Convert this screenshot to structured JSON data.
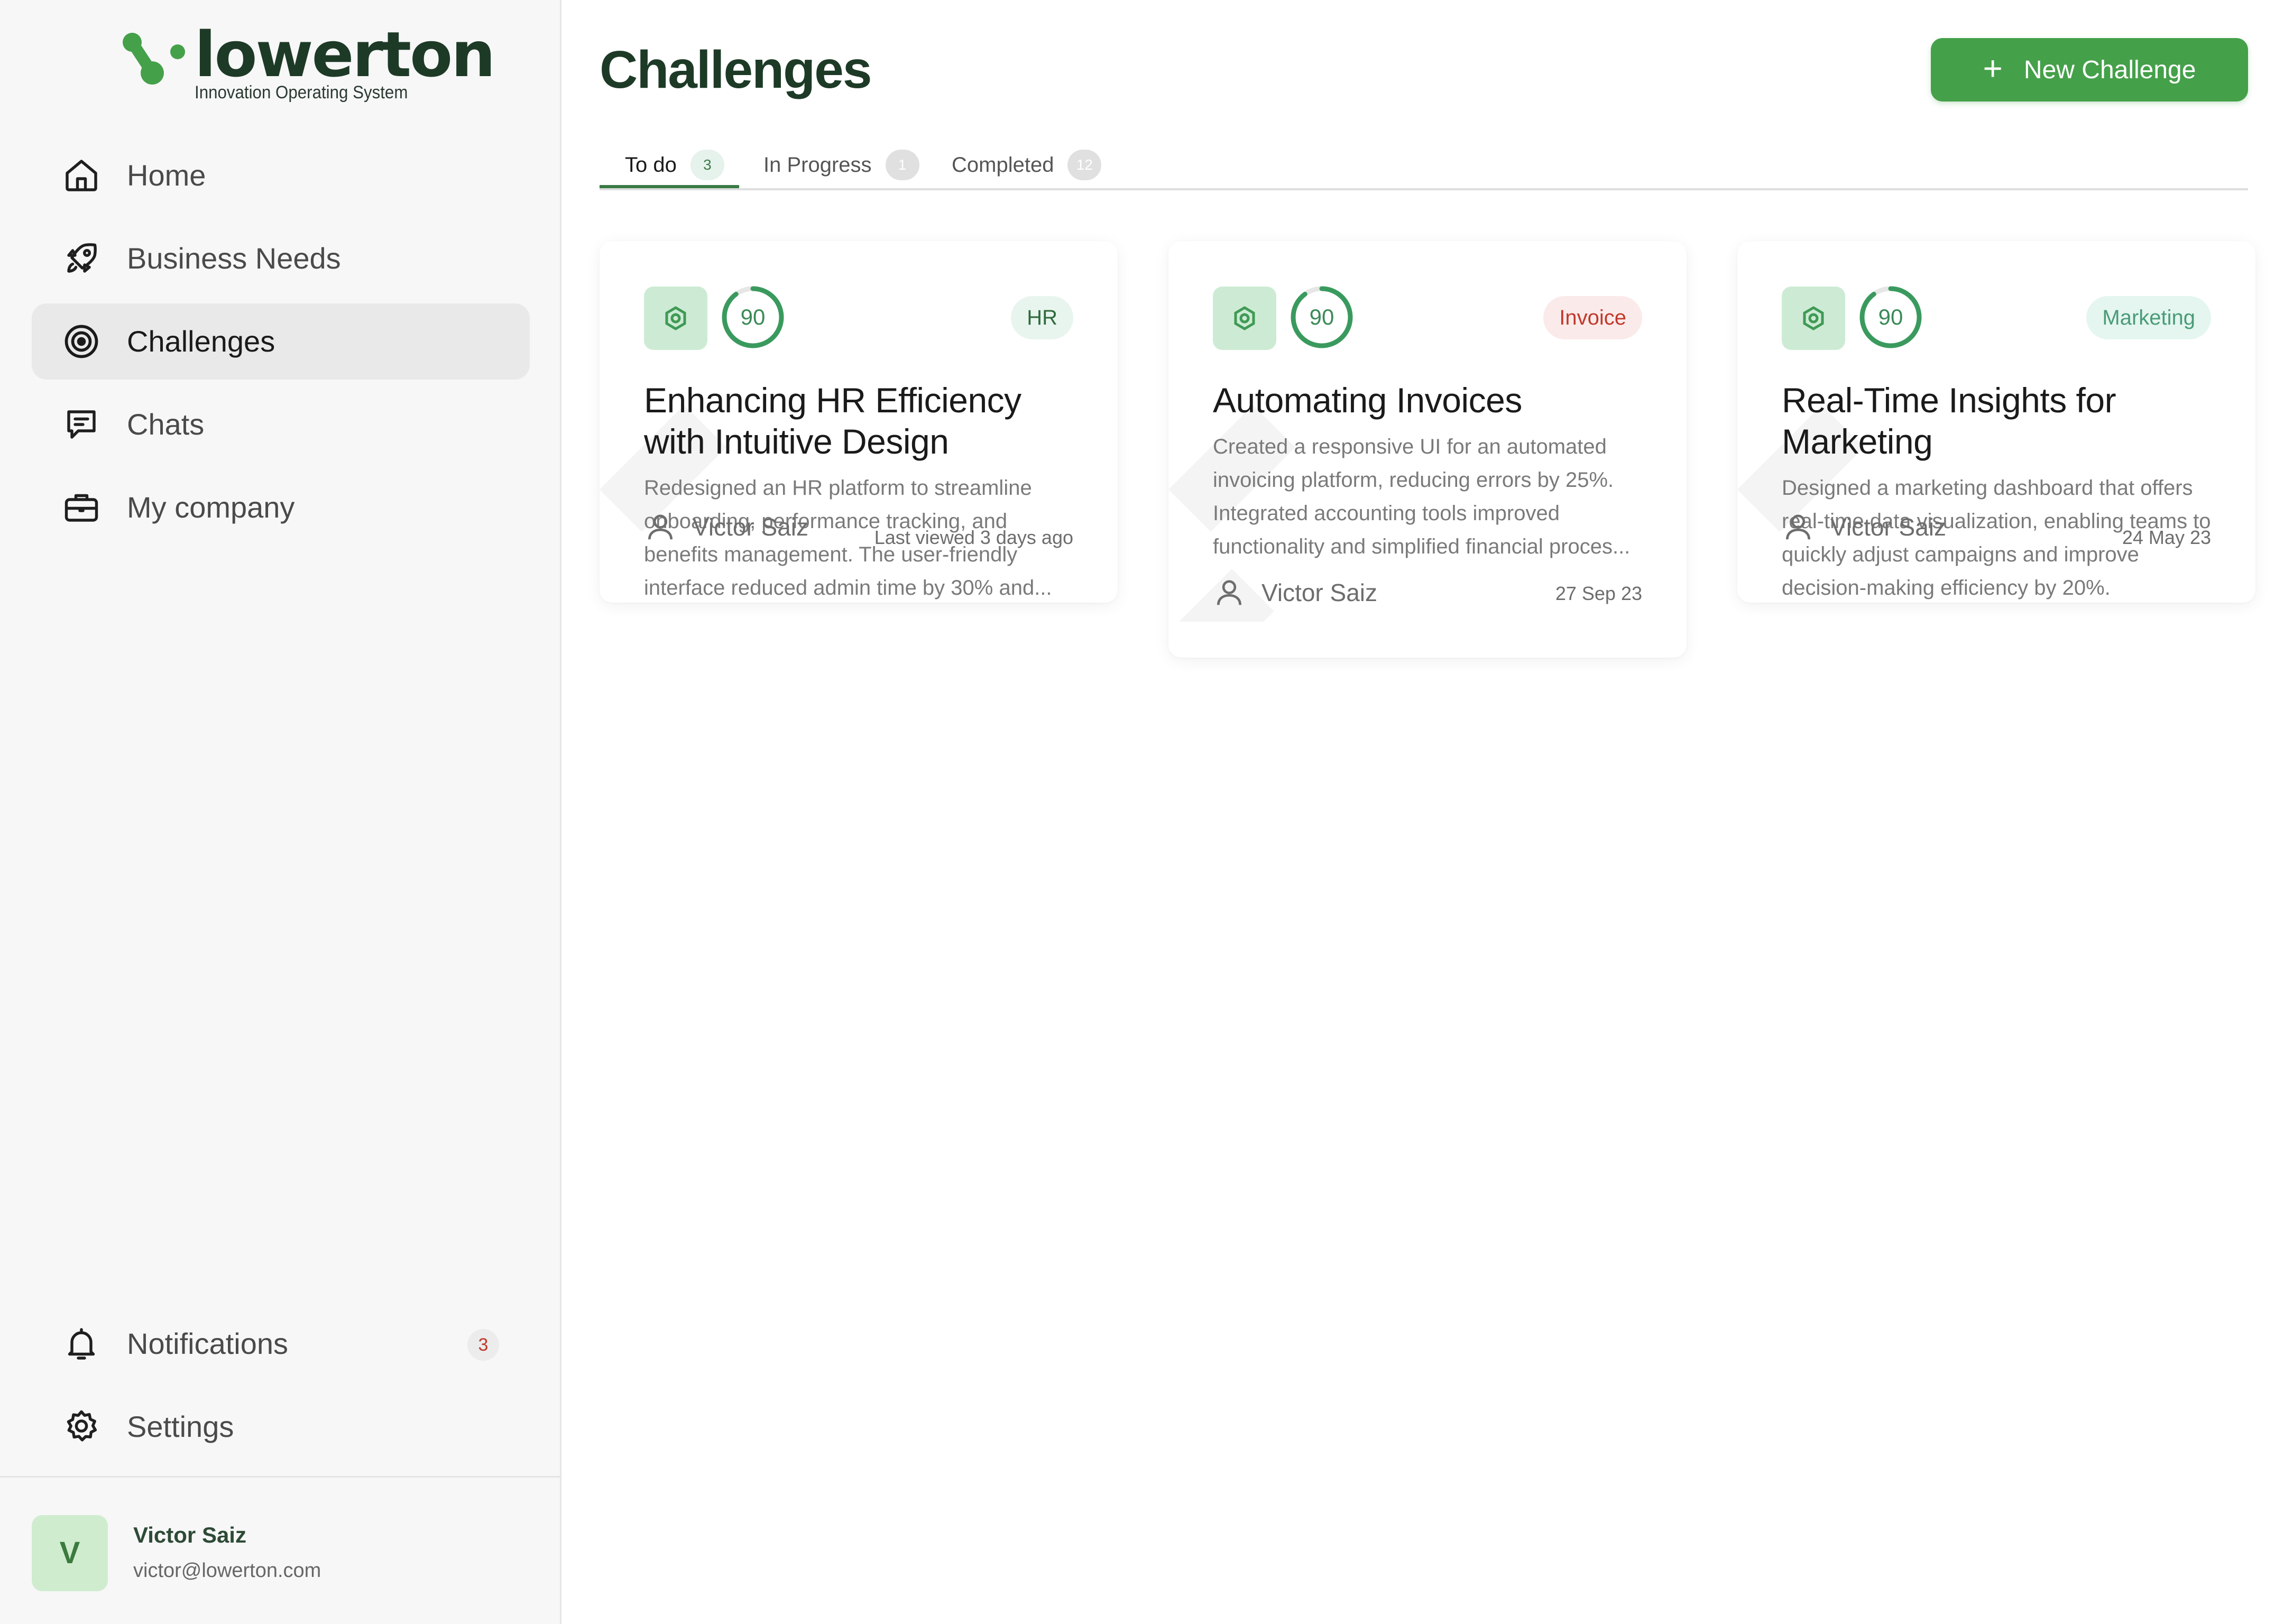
{
  "brand": {
    "name": "lowerton",
    "tagline": "Innovation Operating System",
    "accent": "#45a04a",
    "dark": "#1d3a27"
  },
  "sidebar": {
    "items": [
      {
        "label": "Home",
        "icon": "home-icon"
      },
      {
        "label": "Business Needs",
        "icon": "rocket-icon"
      },
      {
        "label": "Challenges",
        "icon": "target-icon",
        "active": true
      },
      {
        "label": "Chats",
        "icon": "chat-icon"
      },
      {
        "label": "My company",
        "icon": "briefcase-icon"
      }
    ],
    "bottom": [
      {
        "label": "Notifications",
        "icon": "bell-icon",
        "badge": "3"
      },
      {
        "label": "Settings",
        "icon": "gear-icon"
      }
    ],
    "user": {
      "initial": "V",
      "name": "Victor Saiz",
      "email": "victor@lowerton.com"
    }
  },
  "main": {
    "title": "Challenges",
    "new_button": "New Challenge",
    "tabs": [
      {
        "label": "To do",
        "count": "3",
        "active": true
      },
      {
        "label": "In Progress",
        "count": "1"
      },
      {
        "label": "Completed",
        "count": "12"
      }
    ]
  },
  "cards": [
    {
      "score": "90",
      "tag": "HR",
      "title": "Enhancing HR Efficiency with Intuitive Design",
      "description": "Redesigned an HR platform to streamline onboarding, performance tracking, and benefits management. The user-friendly interface reduced admin time by 30% and...",
      "author": "Victor Saiz",
      "date": "Last viewed 3 days ago"
    },
    {
      "score": "90",
      "tag": "Invoice",
      "title": "Automating Invoices",
      "description": "Created a responsive UI for an automated invoicing platform, reducing errors by 25%. Integrated accounting tools improved functionality and simplified financial proces...",
      "author": "Victor Saiz",
      "date": "27 Sep 23"
    },
    {
      "score": "90",
      "tag": "Marketing",
      "title": "Real-Time Insights for Marketing",
      "description": "Designed a marketing dashboard that offers real-time data visualization, enabling teams to quickly adjust campaigns and improve decision-making efficiency by 20%.",
      "author": "Victor Saiz",
      "date": "24 May 23"
    }
  ]
}
